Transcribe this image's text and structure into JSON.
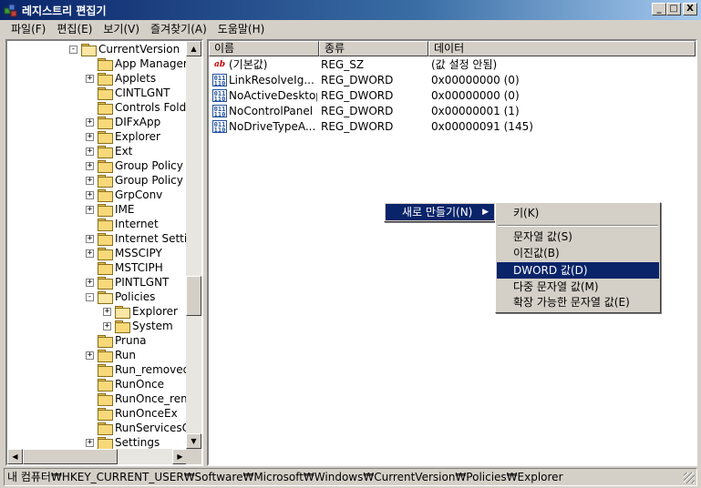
{
  "window": {
    "title": "레지스트리 편집기",
    "controls": {
      "minimize": "_",
      "maximize": "□",
      "close": "X"
    }
  },
  "menubar": [
    {
      "label": "파일(F)"
    },
    {
      "label": "편집(E)"
    },
    {
      "label": "보기(V)"
    },
    {
      "label": "즐겨찾기(A)"
    },
    {
      "label": "도움말(H)"
    }
  ],
  "tree": [
    {
      "label": "CurrentVersion",
      "expander": "-",
      "open": true
    },
    {
      "label": "App Managem",
      "expander": ""
    },
    {
      "label": "Applets",
      "expander": "+"
    },
    {
      "label": "CINTLGNT",
      "expander": ""
    },
    {
      "label": "Controls Folde",
      "expander": ""
    },
    {
      "label": "DIFxApp",
      "expander": "+"
    },
    {
      "label": "Explorer",
      "expander": "+"
    },
    {
      "label": "Ext",
      "expander": "+"
    },
    {
      "label": "Group Policy",
      "expander": "+"
    },
    {
      "label": "Group Policy",
      "expander": "+"
    },
    {
      "label": "GrpConv",
      "expander": "+"
    },
    {
      "label": "IME",
      "expander": "+"
    },
    {
      "label": "Internet",
      "expander": ""
    },
    {
      "label": "Internet Settin",
      "expander": "+"
    },
    {
      "label": "MSSCIPY",
      "expander": "+"
    },
    {
      "label": "MSTCIPH",
      "expander": ""
    },
    {
      "label": "PINTLGNT",
      "expander": "+"
    },
    {
      "label": "Policies",
      "expander": "-",
      "open": true
    },
    {
      "label": "Explorer",
      "expander": "+",
      "open": true
    },
    {
      "label": "System",
      "expander": "+"
    },
    {
      "label": "Pruna",
      "expander": ""
    },
    {
      "label": "Run",
      "expander": "+"
    },
    {
      "label": "Run_removed",
      "expander": ""
    },
    {
      "label": "RunOnce",
      "expander": ""
    },
    {
      "label": "RunOnce_rem",
      "expander": ""
    },
    {
      "label": "RunOnceEx",
      "expander": ""
    },
    {
      "label": "RunServicesO",
      "expander": ""
    },
    {
      "label": "Settings",
      "expander": "+"
    }
  ],
  "list": {
    "columns": [
      "이름",
      "종류",
      "데이터"
    ],
    "rows": [
      {
        "icon": "string-value-icon",
        "glyph": "ab",
        "name": "(기본값)",
        "type": "REG_SZ",
        "data": "(값 설정 안됨)"
      },
      {
        "icon": "dword-value-icon",
        "glyph": "011\n110",
        "name": "LinkResolveIg...",
        "type": "REG_DWORD",
        "data": "0x00000000 (0)"
      },
      {
        "icon": "dword-value-icon",
        "glyph": "011\n110",
        "name": "NoActiveDesktop",
        "type": "REG_DWORD",
        "data": "0x00000000 (0)"
      },
      {
        "icon": "dword-value-icon",
        "glyph": "011\n110",
        "name": "NoControlPanel",
        "type": "REG_DWORD",
        "data": "0x00000001 (1)"
      },
      {
        "icon": "dword-value-icon",
        "glyph": "011\n110",
        "name": "NoDriveTypeA...",
        "type": "REG_DWORD",
        "data": "0x00000091 (145)"
      }
    ]
  },
  "context_menu": {
    "main": {
      "label": "새로 만들기(N)",
      "arrow": "▶"
    },
    "submenu": [
      {
        "label": "키(K)"
      },
      {
        "label": "문자열 값(S)"
      },
      {
        "label": "이진값(B)"
      },
      {
        "label": "DWORD 값(D)",
        "highlighted": true
      },
      {
        "label": "다중 문자열 값(M)"
      },
      {
        "label": "확장 가능한 문자열 값(E)"
      }
    ]
  },
  "statusbar": {
    "path": "내 컴퓨터₩HKEY_CURRENT_USER₩Software₩Microsoft₩Windows₩CurrentVersion₩Policies₩Explorer"
  },
  "colors": {
    "titlebar_start": "#0a246a",
    "highlight": "#0a246a",
    "face": "#d4d0c8"
  }
}
